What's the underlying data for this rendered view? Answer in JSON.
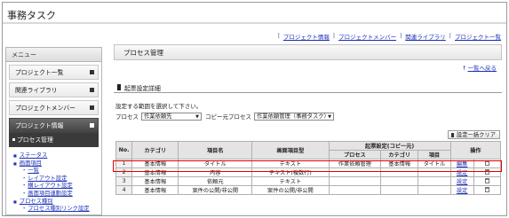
{
  "app": {
    "title": "事務タスク"
  },
  "top_nav": [
    "プロジェクト情報",
    "プロジェクトメンバー",
    "関連ライブラリ",
    "プロジェクト一覧"
  ],
  "sidebar": {
    "header": "メニュー",
    "items": [
      {
        "label": "プロジェクト一覧",
        "active": false
      },
      {
        "label": "関連ライブラリ",
        "active": false
      },
      {
        "label": "プロジェクトメンバー",
        "active": false
      },
      {
        "label": "プロジェクト情報",
        "active": true
      }
    ],
    "sub_selected": "プロセス管理",
    "tree": [
      {
        "label": "ステータス",
        "level": 1
      },
      {
        "label": "画面項目",
        "level": 1
      },
      {
        "label": "一覧",
        "level": 2
      },
      {
        "label": "レイアウト設定",
        "level": 2
      },
      {
        "label": "横レイアウト設定",
        "level": 2
      },
      {
        "label": "画面項目連動設定",
        "level": 2
      },
      {
        "label": "プロセス種別",
        "level": 1
      },
      {
        "label": "プロセス種別リンク設定",
        "level": 2
      }
    ]
  },
  "main": {
    "title": "プロセス管理",
    "back_link": "一覧へ戻る",
    "section_title": "起票設定詳細",
    "instruction": "設定する範囲を選択して下さい。",
    "process_label": "プロセス",
    "process_value": "作業依頼先",
    "copy_label": "コピー元プロセス",
    "copy_value": "作業依頼管理（事務タスク）",
    "clear_button": "設定一括クリア"
  },
  "table": {
    "headers": {
      "no": "No.",
      "category": "カテゴリ",
      "item_name": "項目名",
      "screen_type": "画面項目型",
      "group": "起票設定(コピー元)",
      "process": "プロセス",
      "sub_category": "カテゴリ",
      "item": "項目",
      "action": "操作"
    },
    "rows": [
      {
        "no": "1",
        "category": "基本情報",
        "item_name": "タイトル",
        "screen_type": "テキスト",
        "process": "作業依頼管理",
        "sub_category": "基本情報",
        "item": "タイトル",
        "edit": "編集",
        "highlighted": true
      },
      {
        "no": "2",
        "category": "基本情報",
        "item_name": "内容",
        "screen_type": "テキスト(複数行)",
        "process": "",
        "sub_category": "",
        "item": "",
        "edit": "設定",
        "highlighted": false
      },
      {
        "no": "3",
        "category": "基本情報",
        "item_name": "依頼元",
        "screen_type": "テキスト",
        "process": "",
        "sub_category": "",
        "item": "",
        "edit": "設定",
        "highlighted": false
      },
      {
        "no": "4",
        "category": "基本情報",
        "item_name": "案件の公開/非公開",
        "screen_type": "案件の公開/非公開",
        "process": "",
        "sub_category": "",
        "item": "",
        "edit": "設定",
        "highlighted": false
      }
    ]
  },
  "colors": {
    "link": "#1a2fb5",
    "highlight": "#e00000",
    "active_menu": "#444444"
  }
}
